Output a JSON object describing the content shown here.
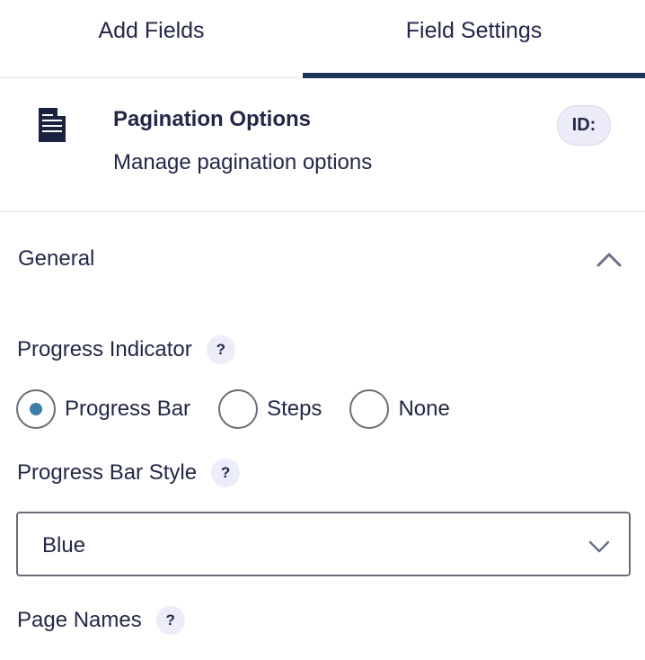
{
  "tabs": {
    "add_fields": "Add Fields",
    "field_settings": "Field Settings"
  },
  "field": {
    "icon": "document-icon",
    "title": "Pagination Options",
    "description": "Manage pagination options",
    "id_label": "ID:"
  },
  "section": {
    "title": "General",
    "expanded": true
  },
  "progress_indicator": {
    "label": "Progress Indicator",
    "help": "?",
    "options": [
      "Progress Bar",
      "Steps",
      "None"
    ],
    "selected": "Progress Bar"
  },
  "progress_bar_style": {
    "label": "Progress Bar Style",
    "help": "?",
    "value": "Blue"
  },
  "page_names": {
    "label": "Page Names",
    "help": "?"
  },
  "colors": {
    "active_tab_underline": "#1b3559",
    "radio_selected": "#3e7da6",
    "text": "#242748",
    "badge_bg": "#ecedf8"
  }
}
